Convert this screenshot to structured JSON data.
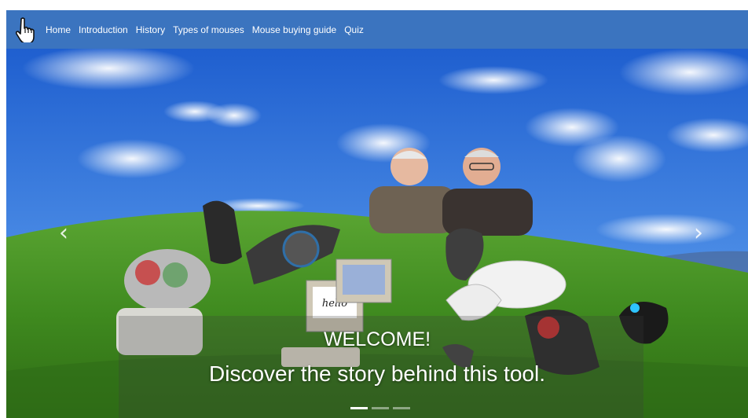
{
  "navbar": {
    "brand_icon": "hand-pointer-icon",
    "links": [
      {
        "label": "Home"
      },
      {
        "label": "Introduction"
      },
      {
        "label": "History"
      },
      {
        "label": "Types of mouses"
      },
      {
        "label": "Mouse buying guide"
      },
      {
        "label": "Quiz"
      }
    ],
    "background": "#3b74bf"
  },
  "carousel": {
    "caption_title": "WELCOME!",
    "caption_subtitle": "Discover the story behind this tool.",
    "prev_icon": "chevron-left-icon",
    "next_icon": "chevron-right-icon",
    "prev_glyph": "‹",
    "next_glyph": "›",
    "slide_count": 3,
    "active_slide": 1,
    "screen_text": "hello"
  }
}
